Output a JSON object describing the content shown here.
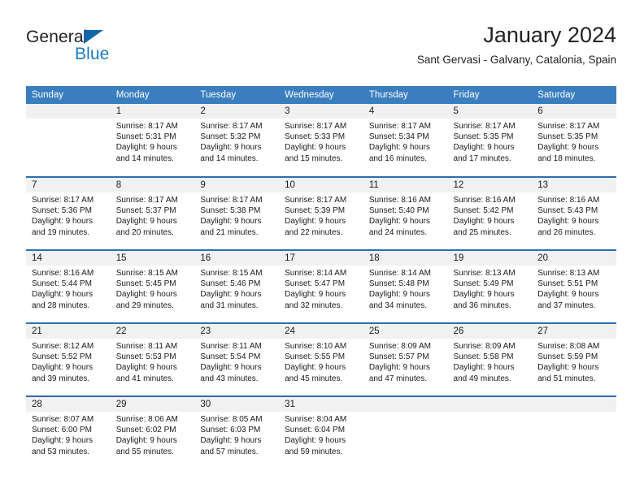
{
  "logo": {
    "word1": "General",
    "word2": "Blue",
    "triangle_color": "#1464aa",
    "word2_color": "#1b7bc4"
  },
  "header": {
    "title": "January 2024",
    "subtitle": "Sant Gervasi - Galvany, Catalonia, Spain"
  },
  "colors": {
    "header_row_bg": "#3a7ebf",
    "header_row_text": "#ffffff",
    "row_separator": "#2b6cb0",
    "daynum_bg": "#f1f1f1"
  },
  "calendar": {
    "weekday_headers": [
      "Sunday",
      "Monday",
      "Tuesday",
      "Wednesday",
      "Thursday",
      "Friday",
      "Saturday"
    ],
    "weeks": [
      [
        {
          "day": "",
          "sunrise": "",
          "sunset": "",
          "daylight1": "",
          "daylight2": ""
        },
        {
          "day": "1",
          "sunrise": "Sunrise: 8:17 AM",
          "sunset": "Sunset: 5:31 PM",
          "daylight1": "Daylight: 9 hours",
          "daylight2": "and 14 minutes."
        },
        {
          "day": "2",
          "sunrise": "Sunrise: 8:17 AM",
          "sunset": "Sunset: 5:32 PM",
          "daylight1": "Daylight: 9 hours",
          "daylight2": "and 14 minutes."
        },
        {
          "day": "3",
          "sunrise": "Sunrise: 8:17 AM",
          "sunset": "Sunset: 5:33 PM",
          "daylight1": "Daylight: 9 hours",
          "daylight2": "and 15 minutes."
        },
        {
          "day": "4",
          "sunrise": "Sunrise: 8:17 AM",
          "sunset": "Sunset: 5:34 PM",
          "daylight1": "Daylight: 9 hours",
          "daylight2": "and 16 minutes."
        },
        {
          "day": "5",
          "sunrise": "Sunrise: 8:17 AM",
          "sunset": "Sunset: 5:35 PM",
          "daylight1": "Daylight: 9 hours",
          "daylight2": "and 17 minutes."
        },
        {
          "day": "6",
          "sunrise": "Sunrise: 8:17 AM",
          "sunset": "Sunset: 5:35 PM",
          "daylight1": "Daylight: 9 hours",
          "daylight2": "and 18 minutes."
        }
      ],
      [
        {
          "day": "7",
          "sunrise": "Sunrise: 8:17 AM",
          "sunset": "Sunset: 5:36 PM",
          "daylight1": "Daylight: 9 hours",
          "daylight2": "and 19 minutes."
        },
        {
          "day": "8",
          "sunrise": "Sunrise: 8:17 AM",
          "sunset": "Sunset: 5:37 PM",
          "daylight1": "Daylight: 9 hours",
          "daylight2": "and 20 minutes."
        },
        {
          "day": "9",
          "sunrise": "Sunrise: 8:17 AM",
          "sunset": "Sunset: 5:38 PM",
          "daylight1": "Daylight: 9 hours",
          "daylight2": "and 21 minutes."
        },
        {
          "day": "10",
          "sunrise": "Sunrise: 8:17 AM",
          "sunset": "Sunset: 5:39 PM",
          "daylight1": "Daylight: 9 hours",
          "daylight2": "and 22 minutes."
        },
        {
          "day": "11",
          "sunrise": "Sunrise: 8:16 AM",
          "sunset": "Sunset: 5:40 PM",
          "daylight1": "Daylight: 9 hours",
          "daylight2": "and 24 minutes."
        },
        {
          "day": "12",
          "sunrise": "Sunrise: 8:16 AM",
          "sunset": "Sunset: 5:42 PM",
          "daylight1": "Daylight: 9 hours",
          "daylight2": "and 25 minutes."
        },
        {
          "day": "13",
          "sunrise": "Sunrise: 8:16 AM",
          "sunset": "Sunset: 5:43 PM",
          "daylight1": "Daylight: 9 hours",
          "daylight2": "and 26 minutes."
        }
      ],
      [
        {
          "day": "14",
          "sunrise": "Sunrise: 8:16 AM",
          "sunset": "Sunset: 5:44 PM",
          "daylight1": "Daylight: 9 hours",
          "daylight2": "and 28 minutes."
        },
        {
          "day": "15",
          "sunrise": "Sunrise: 8:15 AM",
          "sunset": "Sunset: 5:45 PM",
          "daylight1": "Daylight: 9 hours",
          "daylight2": "and 29 minutes."
        },
        {
          "day": "16",
          "sunrise": "Sunrise: 8:15 AM",
          "sunset": "Sunset: 5:46 PM",
          "daylight1": "Daylight: 9 hours",
          "daylight2": "and 31 minutes."
        },
        {
          "day": "17",
          "sunrise": "Sunrise: 8:14 AM",
          "sunset": "Sunset: 5:47 PM",
          "daylight1": "Daylight: 9 hours",
          "daylight2": "and 32 minutes."
        },
        {
          "day": "18",
          "sunrise": "Sunrise: 8:14 AM",
          "sunset": "Sunset: 5:48 PM",
          "daylight1": "Daylight: 9 hours",
          "daylight2": "and 34 minutes."
        },
        {
          "day": "19",
          "sunrise": "Sunrise: 8:13 AM",
          "sunset": "Sunset: 5:49 PM",
          "daylight1": "Daylight: 9 hours",
          "daylight2": "and 36 minutes."
        },
        {
          "day": "20",
          "sunrise": "Sunrise: 8:13 AM",
          "sunset": "Sunset: 5:51 PM",
          "daylight1": "Daylight: 9 hours",
          "daylight2": "and 37 minutes."
        }
      ],
      [
        {
          "day": "21",
          "sunrise": "Sunrise: 8:12 AM",
          "sunset": "Sunset: 5:52 PM",
          "daylight1": "Daylight: 9 hours",
          "daylight2": "and 39 minutes."
        },
        {
          "day": "22",
          "sunrise": "Sunrise: 8:11 AM",
          "sunset": "Sunset: 5:53 PM",
          "daylight1": "Daylight: 9 hours",
          "daylight2": "and 41 minutes."
        },
        {
          "day": "23",
          "sunrise": "Sunrise: 8:11 AM",
          "sunset": "Sunset: 5:54 PM",
          "daylight1": "Daylight: 9 hours",
          "daylight2": "and 43 minutes."
        },
        {
          "day": "24",
          "sunrise": "Sunrise: 8:10 AM",
          "sunset": "Sunset: 5:55 PM",
          "daylight1": "Daylight: 9 hours",
          "daylight2": "and 45 minutes."
        },
        {
          "day": "25",
          "sunrise": "Sunrise: 8:09 AM",
          "sunset": "Sunset: 5:57 PM",
          "daylight1": "Daylight: 9 hours",
          "daylight2": "and 47 minutes."
        },
        {
          "day": "26",
          "sunrise": "Sunrise: 8:09 AM",
          "sunset": "Sunset: 5:58 PM",
          "daylight1": "Daylight: 9 hours",
          "daylight2": "and 49 minutes."
        },
        {
          "day": "27",
          "sunrise": "Sunrise: 8:08 AM",
          "sunset": "Sunset: 5:59 PM",
          "daylight1": "Daylight: 9 hours",
          "daylight2": "and 51 minutes."
        }
      ],
      [
        {
          "day": "28",
          "sunrise": "Sunrise: 8:07 AM",
          "sunset": "Sunset: 6:00 PM",
          "daylight1": "Daylight: 9 hours",
          "daylight2": "and 53 minutes."
        },
        {
          "day": "29",
          "sunrise": "Sunrise: 8:06 AM",
          "sunset": "Sunset: 6:02 PM",
          "daylight1": "Daylight: 9 hours",
          "daylight2": "and 55 minutes."
        },
        {
          "day": "30",
          "sunrise": "Sunrise: 8:05 AM",
          "sunset": "Sunset: 6:03 PM",
          "daylight1": "Daylight: 9 hours",
          "daylight2": "and 57 minutes."
        },
        {
          "day": "31",
          "sunrise": "Sunrise: 8:04 AM",
          "sunset": "Sunset: 6:04 PM",
          "daylight1": "Daylight: 9 hours",
          "daylight2": "and 59 minutes."
        },
        {
          "day": "",
          "sunrise": "",
          "sunset": "",
          "daylight1": "",
          "daylight2": ""
        },
        {
          "day": "",
          "sunrise": "",
          "sunset": "",
          "daylight1": "",
          "daylight2": ""
        },
        {
          "day": "",
          "sunrise": "",
          "sunset": "",
          "daylight1": "",
          "daylight2": ""
        }
      ]
    ]
  }
}
